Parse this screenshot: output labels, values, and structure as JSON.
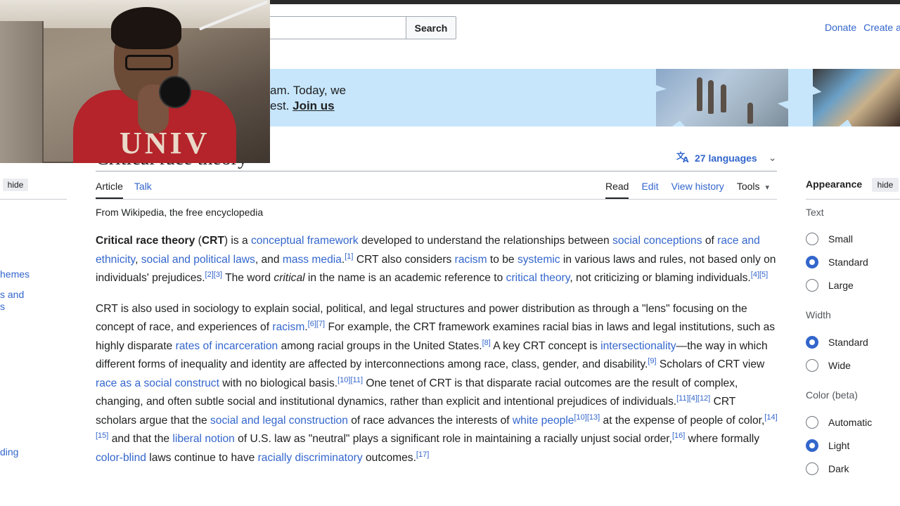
{
  "search": {
    "button_label": "Search"
  },
  "top_links": [
    "Donate",
    "Create a"
  ],
  "banner": {
    "line1": "am. Today, we",
    "line2_prefix": "est. ",
    "line2_link": "Join us"
  },
  "webcam": {
    "shirt_text": "UNIV"
  },
  "article": {
    "title_fragment": "Critical race theory",
    "languages": "27 languages",
    "tabs_left": [
      "Article",
      "Talk"
    ],
    "tabs_right": [
      "Read",
      "Edit",
      "View history",
      "Tools"
    ],
    "from": "From Wikipedia, the free encyclopedia"
  },
  "left_sidebar": {
    "hide_label": "hide",
    "items": [
      "hemes",
      "s and",
      "s",
      "ding"
    ]
  },
  "appearance": {
    "title": "Appearance",
    "hide_label": "hide",
    "text_label": "Text",
    "text_options": [
      {
        "label": "Small",
        "selected": false
      },
      {
        "label": "Standard",
        "selected": true
      },
      {
        "label": "Large",
        "selected": false
      }
    ],
    "width_label": "Width",
    "width_options": [
      {
        "label": "Standard",
        "selected": true
      },
      {
        "label": "Wide",
        "selected": false
      }
    ],
    "color_label": "Color (beta)",
    "color_options": [
      {
        "label": "Automatic",
        "selected": false
      },
      {
        "label": "Light",
        "selected": true
      },
      {
        "label": "Dark",
        "selected": false
      }
    ]
  },
  "colors": {
    "link": "#3366cc",
    "banner_bg": "#c7e6fb",
    "text": "#202122"
  },
  "paragraphs": {
    "p1": {
      "bold1": "Critical race theory",
      "t1": " (",
      "bold2": "CRT",
      "t2": ") is a ",
      "l1": "conceptual framework",
      "t3": " developed to understand the relationships between ",
      "l2": "social conceptions",
      "t4": " of ",
      "l3": "race and ethnicity",
      "t5": ", ",
      "l4": "social and political laws",
      "t6": ", and ",
      "l5": "mass media",
      "t7": ".",
      "s1": "[1]",
      "t8": " CRT also considers ",
      "l6": "racism",
      "t9": " to be ",
      "l7": "systemic",
      "t10": " in various laws and rules, not based only on individuals' prejudices.",
      "s2": "[2][3]",
      "t11": " The word ",
      "i1": "critical",
      "t12": " in the name is an academic reference to ",
      "l8": "critical theory",
      "t13": ", not criticizing or blaming individuals.",
      "s3": "[4][5]"
    },
    "p2": {
      "t1": "CRT is also used in sociology to explain social, political, and legal structures and power distribution as through a \"lens\" focusing on the concept of race, and experiences of ",
      "l1": "racism",
      "t2": ".",
      "s1": "[6][7]",
      "t3": " For example, the CRT framework examines racial bias in laws and legal institutions, such as highly disparate ",
      "l2": "rates of incarceration",
      "t4": " among racial groups in the United States.",
      "s2": "[8]",
      "t5": " A key CRT concept is ",
      "l3": "intersectionality",
      "t6": "—the way in which different forms of inequality and identity are affected by interconnections among race, class, gender, and disability.",
      "s3": "[9]",
      "t7": " Scholars of CRT view ",
      "l4": "race as a social construct",
      "t8": " with no biological basis.",
      "s4": "[10][11]",
      "t9": " One tenet of CRT is that disparate racial outcomes are the result of complex, changing, and often subtle social and institutional dynamics, rather than explicit and intentional prejudices of individuals.",
      "s5": "[11][4][12]",
      "t10": " CRT scholars argue that the ",
      "l5": "social and legal construction",
      "t11": " of race advances the interests of ",
      "l6": "white people",
      "s6": "[10][13]",
      "t12": " at the expense of people of color,",
      "s7": "[14][15]",
      "t13": " and that the ",
      "l7": "liberal notion",
      "t14": " of U.S. law as \"neutral\" plays a significant role in maintaining a racially unjust social order,",
      "s8": "[16]",
      "t15": " where formally ",
      "l8": "color-blind",
      "t16": " laws continue to have ",
      "l9": "racially discriminatory",
      "t17": " outcomes.",
      "s9": "[17]"
    }
  }
}
